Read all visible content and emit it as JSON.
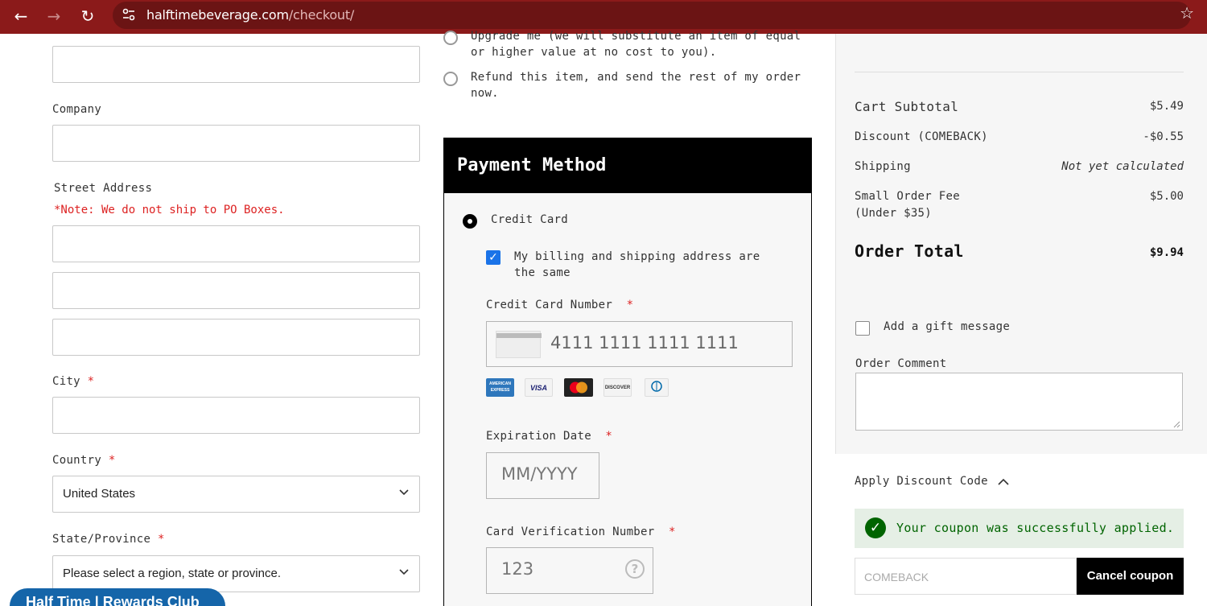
{
  "browser": {
    "url_domain": "halftimebeverage.com",
    "url_path": "/checkout/"
  },
  "shipping_form": {
    "company_label": "Company",
    "street_label": "Street Address",
    "street_note": "*Note: We do not ship to PO Boxes.",
    "city_label": "City",
    "country_label": "Country",
    "country_value": "United States",
    "state_label": "State/Province",
    "state_value": "Please select a region, state or province.",
    "required_mark": "*"
  },
  "rewards_tab": "Half Time | Rewards Club",
  "substitution_options": [
    {
      "label": "Upgrade me (we will substitute an item of equal or higher value at no cost to you)."
    },
    {
      "label": "Refund this item, and send the rest of my order now."
    }
  ],
  "payment": {
    "heading": "Payment Method",
    "method_label": "Credit Card",
    "billing_same_label": "My billing and shipping address are the same",
    "cc_number_label": "Credit Card Number",
    "cc_number_value": "4111 1111 1111 1111",
    "card_brands": [
      "AMERICAN EXPRESS",
      "VISA",
      "Mastercard",
      "DISCOVER",
      "Diners Club"
    ],
    "expiration_label": "Expiration Date",
    "expiration_placeholder": "MM/YYYY",
    "cvv_label": "Card Verification Number",
    "cvv_placeholder": "123",
    "required_mark": "*"
  },
  "summary": {
    "subtotal_label": "Cart Subtotal",
    "subtotal_value": "$5.49",
    "discount_label": "Discount (COMEBACK)",
    "discount_value": "-$0.55",
    "shipping_label": "Shipping",
    "shipping_value": "Not yet calculated",
    "fee_label": "Small Order Fee",
    "fee_sublabel": "(Under $35)",
    "fee_value": "$5.00",
    "total_label": "Order Total",
    "total_value": "$9.94"
  },
  "gift": {
    "gift_label": "Add a gift message",
    "comment_label": "Order Comment"
  },
  "discount": {
    "heading": "Apply Discount Code",
    "success_message": "Your coupon was successfully applied.",
    "code_value": "COMEBACK",
    "cancel_label": "Cancel coupon"
  },
  "colors": {
    "browser_bar": "#8b1a1a",
    "required": "#dd2222",
    "success_text": "#006400",
    "rewards_tab": "#1565a9"
  }
}
